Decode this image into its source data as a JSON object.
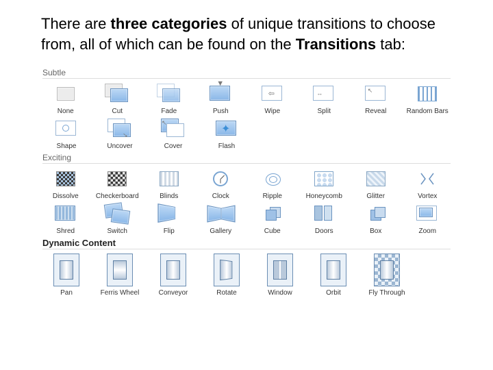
{
  "intro": {
    "prefix": "There are ",
    "bold1": "three categories",
    "mid": " of unique transitions to choose from, all of which can be found on the ",
    "bold2": "Transitions",
    "suffix": " tab:"
  },
  "categories": {
    "subtle": {
      "header": "Subtle"
    },
    "exciting": {
      "header": "Exciting"
    },
    "dynamic": {
      "header": "Dynamic Content"
    }
  },
  "subtle_row1": [
    {
      "label": "None"
    },
    {
      "label": "Cut"
    },
    {
      "label": "Fade"
    },
    {
      "label": "Push"
    },
    {
      "label": "Wipe"
    },
    {
      "label": "Split"
    },
    {
      "label": "Reveal"
    },
    {
      "label": "Random Bars"
    }
  ],
  "subtle_row2": [
    {
      "label": "Shape"
    },
    {
      "label": "Uncover"
    },
    {
      "label": "Cover"
    },
    {
      "label": "Flash"
    }
  ],
  "exciting_row1": [
    {
      "label": "Dissolve"
    },
    {
      "label": "Checkerboard"
    },
    {
      "label": "Blinds"
    },
    {
      "label": "Clock"
    },
    {
      "label": "Ripple"
    },
    {
      "label": "Honeycomb"
    },
    {
      "label": "Glitter"
    },
    {
      "label": "Vortex"
    }
  ],
  "exciting_row2": [
    {
      "label": "Shred"
    },
    {
      "label": "Switch"
    },
    {
      "label": "Flip"
    },
    {
      "label": "Gallery"
    },
    {
      "label": "Cube"
    },
    {
      "label": "Doors"
    },
    {
      "label": "Box"
    },
    {
      "label": "Zoom"
    }
  ],
  "dynamic_row": [
    {
      "label": "Pan"
    },
    {
      "label": "Ferris Wheel"
    },
    {
      "label": "Conveyor"
    },
    {
      "label": "Rotate"
    },
    {
      "label": "Window"
    },
    {
      "label": "Orbit"
    },
    {
      "label": "Fly Through"
    }
  ]
}
